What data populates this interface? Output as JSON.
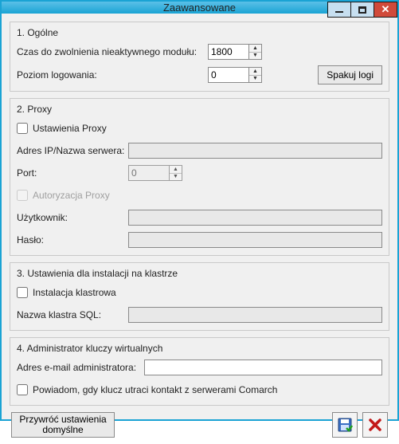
{
  "window": {
    "title": "Zaawansowane"
  },
  "general": {
    "title": "1. Ogólne",
    "timeout_label": "Czas do zwolnienia nieaktywnego modułu:",
    "timeout_value": "1800",
    "loglevel_label": "Poziom logowania:",
    "loglevel_value": "0",
    "packlogs_button": "Spakuj logi"
  },
  "proxy": {
    "title": "2. Proxy",
    "enable_label": "Ustawienia Proxy",
    "enable_checked": false,
    "host_label": "Adres IP/Nazwa serwera:",
    "host_value": "",
    "port_label": "Port:",
    "port_value": "0",
    "auth_label": "Autoryzacja Proxy",
    "auth_checked": false,
    "auth_disabled": true,
    "user_label": "Użytkownik:",
    "user_value": "",
    "pass_label": "Hasło:",
    "pass_value": ""
  },
  "cluster": {
    "title": "3. Ustawienia dla instalacji na klastrze",
    "enable_label": "Instalacja klastrowa",
    "enable_checked": false,
    "name_label": "Nazwa klastra SQL:",
    "name_value": ""
  },
  "admin": {
    "title": "4. Administrator kluczy wirtualnych",
    "email_label": "Adres e-mail administratora:",
    "email_value": "",
    "notify_label": "Powiadom, gdy klucz utraci kontakt z serwerami Comarch",
    "notify_checked": false
  },
  "footer": {
    "restore_defaults": "Przywróć ustawienia domyślne"
  }
}
